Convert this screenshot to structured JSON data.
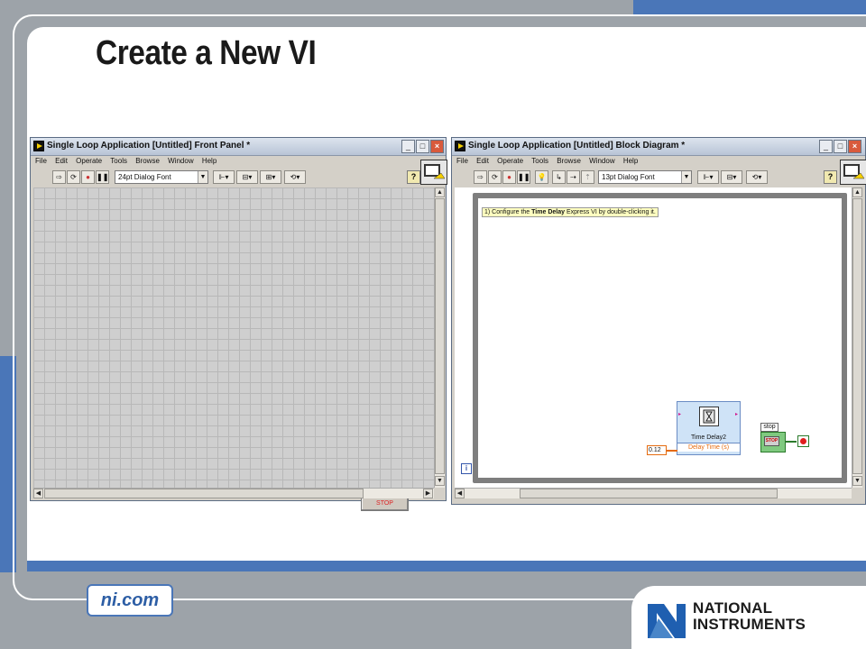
{
  "slide": {
    "title": "Create a New VI",
    "badge": "ni.com",
    "logo_line1": "NATIONAL",
    "logo_line2": "INSTRUMENTS"
  },
  "colors": {
    "accent_blue": "#4a76b8",
    "slide_gray": "#9da3a9",
    "window_gray": "#d4d0c8",
    "orange": "#e56b0f",
    "green": "#2a7a2a"
  },
  "front_panel": {
    "title": "Single Loop Application [Untitled] Front Panel *",
    "menu": [
      "File",
      "Edit",
      "Operate",
      "Tools",
      "Browse",
      "Window",
      "Help"
    ],
    "font_select": "24pt Dialog Font",
    "stop_button": "STOP",
    "help": "?"
  },
  "block_diagram": {
    "title": "Single Loop Application [Untitled] Block Diagram *",
    "menu": [
      "File",
      "Edit",
      "Operate",
      "Tools",
      "Browse",
      "Window",
      "Help"
    ],
    "font_select": "13pt Dialog Font",
    "comment_pre": "1) Configure the ",
    "comment_bold": "Time Delay",
    "comment_post": " Express VI by double-clicking it.",
    "node_label": "Time Delay2",
    "node_terminal": "Delay Time (s)",
    "constant": "0.12",
    "stop_label": "stop",
    "stop_inner": "STOP",
    "iteration": "i",
    "help": "?"
  },
  "icons": [
    "run-arrow-icon",
    "run-continuous-icon",
    "abort-icon",
    "pause-icon",
    "highlight-icon",
    "retain-icon",
    "step-icon",
    "align-icon",
    "distribute-icon",
    "resize-icon",
    "reorder-icon",
    "help-icon",
    "hourglass-icon"
  ]
}
